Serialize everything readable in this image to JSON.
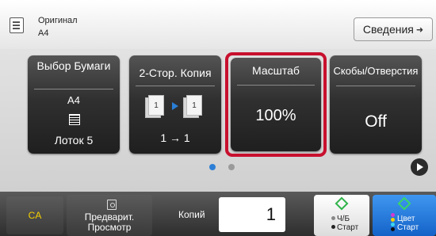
{
  "header": {
    "original_label": "Оригинал",
    "original_size": "A4",
    "details_label": "Сведения",
    "details_arrow": "➜"
  },
  "tiles": {
    "paper": {
      "title": "Выбор Бумаги",
      "size": "A4",
      "tray": "Лоток 5"
    },
    "duplex": {
      "title": "2-Стор. Копия",
      "mode": "1 → 1",
      "page_front": "1",
      "page_back": "1"
    },
    "scale": {
      "title": "Масштаб",
      "value": "100%",
      "selected": true,
      "highlight_color": "#c8102e"
    },
    "staple": {
      "title": "Скобы/Отверстия",
      "value": "Off"
    }
  },
  "pagination": {
    "current_page": 1,
    "total_pages": 2,
    "active_color": "#2d7fd6"
  },
  "footer": {
    "ca_label": "CA",
    "preview_label": "Предварит. Просмотр",
    "copies_label": "Копий",
    "copies_value": "1",
    "bw_start": {
      "line1": "Ч/Б",
      "line2": "Старт"
    },
    "color_start": {
      "line1": "Цвет",
      "line2": "Старт"
    }
  },
  "icons": [
    "original-document-icon",
    "paper-tray-icon",
    "duplex-pages-icon",
    "next-page-icon",
    "preview-icon",
    "start-diamond-icon"
  ]
}
